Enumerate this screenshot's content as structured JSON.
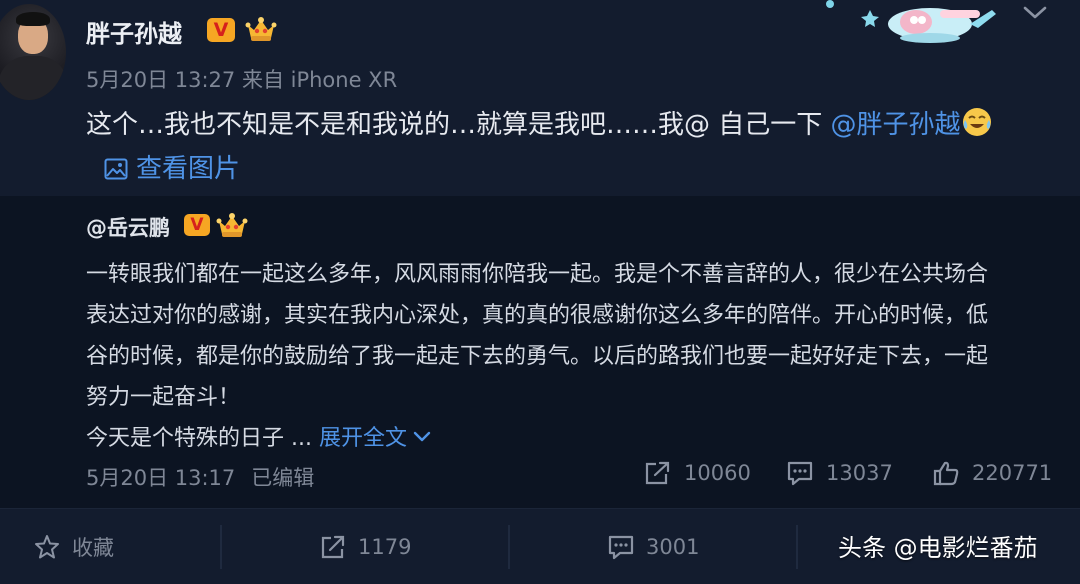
{
  "post": {
    "author": "胖子孙越",
    "verified_badge": "V",
    "meta": "5月20日 13:27 来自 iPhone XR",
    "content_prefix": "这个…我也不知是不是和我说的…就算是我吧……我@ 自己一下 ",
    "content_mention": "@胖子孙越",
    "view_pictures": "查看图片"
  },
  "repost": {
    "author": "@岳云鹏",
    "verified_badge": "V",
    "lines": [
      "一转眼我们都在一起这么多年，风风雨雨你陪我一起。我是个不善言辞的人，很少在公共场合",
      "表达过对你的感谢，其实在我内心深处，真的真的很感谢你这么多年的陪伴。开心的时候，低",
      "谷的时候，都是你的鼓励给了我一起走下去的勇气。以后的路我们也要一起好好走下去，一起",
      "努力一起奋斗！"
    ],
    "truncated_line": "今天是个特殊的日子 ... ",
    "expand_label": "展开全文",
    "time": "5月20日 13:17",
    "edited": "已编辑",
    "reposts": "10060",
    "comments": "13037",
    "likes": "220771"
  },
  "bottom_bar": {
    "favorite_label": "收藏",
    "repost_count": "1179",
    "comment_count": "3001"
  },
  "watermark": "头条 @电影烂番茄",
  "colors": {
    "background": "#131c2e",
    "repost_background": "#0c1422",
    "link": "#4f93e6",
    "muted": "#7f8796",
    "badge": "#f6a623"
  }
}
